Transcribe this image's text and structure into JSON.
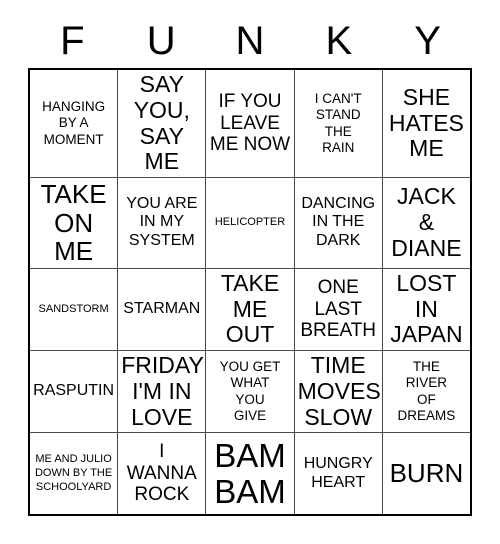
{
  "card": {
    "header_letters": [
      "F",
      "U",
      "N",
      "K",
      "Y"
    ],
    "rows": [
      [
        {
          "text": "HANGING\nBY A\nMOMENT",
          "size": "sm"
        },
        {
          "text": "SAY\nYOU,\nSAY ME",
          "size": "xl"
        },
        {
          "text": "IF YOU\nLEAVE\nME NOW",
          "size": "lg"
        },
        {
          "text": "I CAN'T\nSTAND\nTHE\nRAIN",
          "size": "sm"
        },
        {
          "text": "SHE\nHATES\nME",
          "size": "xl"
        }
      ],
      [
        {
          "text": "TAKE\nON ME",
          "size": "xxl"
        },
        {
          "text": "YOU ARE\nIN MY\nSYSTEM",
          "size": "md"
        },
        {
          "text": "HELICOPTER",
          "size": "xs"
        },
        {
          "text": "DANCING\nIN THE\nDARK",
          "size": "md"
        },
        {
          "text": "JACK\n&\nDIANE",
          "size": "xl"
        }
      ],
      [
        {
          "text": "SANDSTORM",
          "size": "xs"
        },
        {
          "text": "STARMAN",
          "size": "md"
        },
        {
          "text": "TAKE\nME\nOUT",
          "size": "xl"
        },
        {
          "text": "ONE\nLAST\nBREATH",
          "size": "lg"
        },
        {
          "text": "LOST\nIN\nJAPAN",
          "size": "xl"
        }
      ],
      [
        {
          "text": "RASPUTIN",
          "size": "md"
        },
        {
          "text": "FRIDAY\nI'M IN\nLOVE",
          "size": "xl"
        },
        {
          "text": "YOU GET\nWHAT\nYOU\nGIVE",
          "size": "sm"
        },
        {
          "text": "TIME\nMOVES\nSLOW",
          "size": "xl"
        },
        {
          "text": "THE\nRIVER\nOF\nDREAMS",
          "size": "sm"
        }
      ],
      [
        {
          "text": "ME AND JULIO\nDOWN BY THE\nSCHOOLYARD",
          "size": "xs"
        },
        {
          "text": "I\nWANNA\nROCK",
          "size": "lg"
        },
        {
          "text": "BAM\nBAM",
          "size": "huge"
        },
        {
          "text": "HUNGRY\nHEART",
          "size": "md"
        },
        {
          "text": "BURN",
          "size": "xxl"
        }
      ]
    ]
  },
  "colors": {
    "background": "#ffffff",
    "text": "#000000",
    "outer_border": "#000000",
    "inner_border": "#4a4a4a"
  }
}
